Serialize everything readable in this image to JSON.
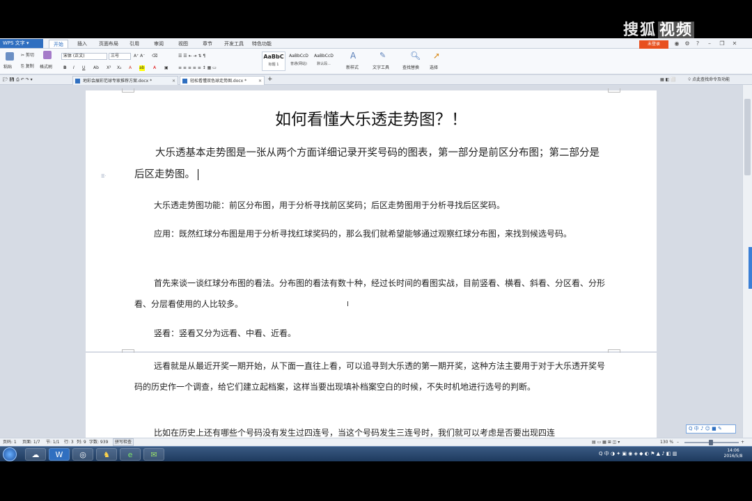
{
  "watermark": {
    "text_a": "搜狐",
    "text_b": "视频"
  },
  "app": {
    "name": "WPS 文字",
    "menu_tabs": [
      "开始",
      "插入",
      "页面布局",
      "引用",
      "审阅",
      "视图",
      "章节",
      "开发工具",
      "特色功能"
    ],
    "login": "未登录"
  },
  "ribbon": {
    "paste": "粘贴",
    "cut": "剪切",
    "copy": "复制",
    "format_painter": "格式刷",
    "font_name": "宋体 (正文)",
    "font_size": "三号",
    "styles": [
      {
        "preview": "AaBbC",
        "name": "标题 1"
      },
      {
        "preview": "AaBbCcD",
        "name": "普通(网站)"
      },
      {
        "preview": "AaBbCcD",
        "name": "默认段..."
      }
    ],
    "new_style": "新样式",
    "text_tools": "文字工具",
    "find_replace": "查找替换",
    "select": "选择",
    "cmd_search": "点此查找命令及功能"
  },
  "doc_tabs": [
    {
      "label": "地彩会展彩范球专家推荐方案.docx *"
    },
    {
      "label": "轻松看懂双色球走势图.docx *"
    }
  ],
  "document": {
    "title": "如何看懂大乐透走势图？！",
    "para1": "大乐透基本走势图是一张从两个方面详细记录开奖号码的图表，第一部分是前区分布图；第二部分是后区走势图。",
    "para2": "大乐透走势图功能：前区分布图，用于分析寻找前区奖码；后区走势图用于分析寻找后区奖码。",
    "para3": "应用：既然红球分布图是用于分析寻找红球奖码的，那么我们就希望能够通过观察红球分布图，来找到候选号码。",
    "para4": "首先来谈一谈红球分布图的看法。分布图的看法有数十种，经过长时间的看图实战，目前竖看、横看、斜看、分区看、分形看、分层看使用的人比较多。",
    "para5": "竖看：竖看又分为远看、中看、近看。",
    "para6": "远看就是从最近开奖一期开始，从下面一直往上看，可以追寻到大乐透的第一期开奖，这种方法主要用于对于大乐透开奖号码的历史作一个调查，给它们建立起档案，这样当要出现填补档案空白的时候，不失时机地进行选号的判断。",
    "para7": "比如在历史上还有哪些个号码没有发生过四连号，当这个号码发生三连号时，我们就可以考虑是否要出现四连"
  },
  "status": {
    "page_num": "页码: 1",
    "pages": "页面: 1/7",
    "section": "节: 1/1",
    "row": "行: 3",
    "col": "列: 9",
    "words": "字数: 939",
    "spell": "拼写检查",
    "zoom": "130 %"
  },
  "float_toolbar": "Q 中 ♪ ☺ ■ ✎",
  "taskbar": {
    "time": "14:06",
    "date": "2016/5/8"
  }
}
